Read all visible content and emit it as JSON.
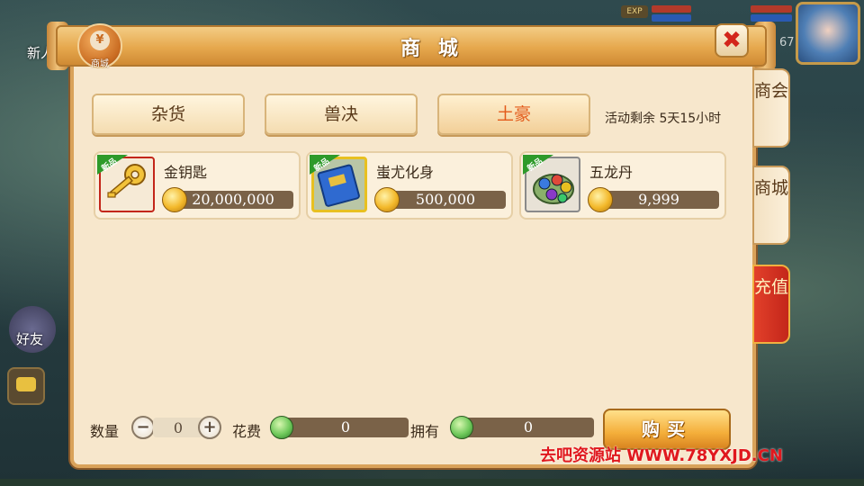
{
  "hud": {
    "newbie_text": "新人",
    "exp_label": "EXP",
    "level_num": "67",
    "friend_label": "好友"
  },
  "shop": {
    "title": "商 城",
    "badge_label": "商城",
    "badge_symbol": "¥",
    "close_symbol": "✖",
    "categories": [
      {
        "label": "杂货",
        "active": false
      },
      {
        "label": "兽决",
        "active": false
      },
      {
        "label": "土豪",
        "active": true
      }
    ],
    "event_text": "活动剩余 5天15小时",
    "new_tag": "新品",
    "items": [
      {
        "name": "金钥匙",
        "price": "20,000,000",
        "icon": "golden-key-icon"
      },
      {
        "name": "蚩尤化身",
        "price": "500,000",
        "icon": "blue-book-icon"
      },
      {
        "name": "五龙丹",
        "price": "9,999",
        "icon": "five-dragon-pill-icon"
      }
    ],
    "side_tabs": [
      {
        "label": "商会"
      },
      {
        "label": "商城"
      },
      {
        "label": "充值"
      }
    ],
    "footer": {
      "qty_label": "数量",
      "qty_minus": "−",
      "qty_plus": "+",
      "qty_value": "0",
      "cost_label": "花费",
      "cost_value": "0",
      "own_label": "拥有",
      "own_value": "0",
      "buy_label": "购买"
    }
  },
  "watermark": "去吧资源站 WWW.78YXJD.CN",
  "colors": {
    "panel_bg": "#f7e7cc",
    "accent_orange": "#e6a84d",
    "active_category": "#e35a1a",
    "recharge_red": "#c3261a",
    "price_bar": "#7a6248"
  }
}
